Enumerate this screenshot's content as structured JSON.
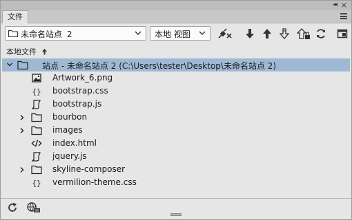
{
  "panel": {
    "tab_label": "文件",
    "collapse_glyph": "◂◂",
    "close_glyph": "×"
  },
  "toolbar": {
    "site_select": {
      "name": "未命名站点",
      "number": "2"
    },
    "view_select": "本地 视图",
    "buttons": [
      "connect-icon",
      "get-icon",
      "put-icon",
      "check-out-icon",
      "check-in-icon",
      "refresh-icon",
      "expand-icon"
    ]
  },
  "location": {
    "label": "本地文件",
    "sort_icon": "sort-ascending-icon"
  },
  "tree": {
    "root": {
      "label": "站点 - 未命名站点 2 (C:\\Users\\tester\\Desktop\\未命名站点 2)",
      "expanded": true,
      "selected": true
    },
    "items": [
      {
        "label": "Artwork_6.png",
        "icon": "image-file-icon",
        "folder": false
      },
      {
        "label": "bootstrap.css",
        "icon": "css-file-icon",
        "folder": false
      },
      {
        "label": "bootstrap.js",
        "icon": "js-file-icon",
        "folder": false
      },
      {
        "label": "bourbon",
        "icon": "folder-icon",
        "folder": true
      },
      {
        "label": "images",
        "icon": "folder-icon",
        "folder": true
      },
      {
        "label": "index.html",
        "icon": "html-file-icon",
        "folder": false
      },
      {
        "label": "jquery.js",
        "icon": "js-file-icon",
        "folder": false
      },
      {
        "label": "skyline-composer",
        "icon": "folder-icon",
        "folder": true
      },
      {
        "label": "vermilion-theme.css",
        "icon": "css-file-icon",
        "folder": false
      }
    ]
  },
  "bottom": {
    "buttons": [
      "refresh-icon",
      "log-icon"
    ]
  }
}
